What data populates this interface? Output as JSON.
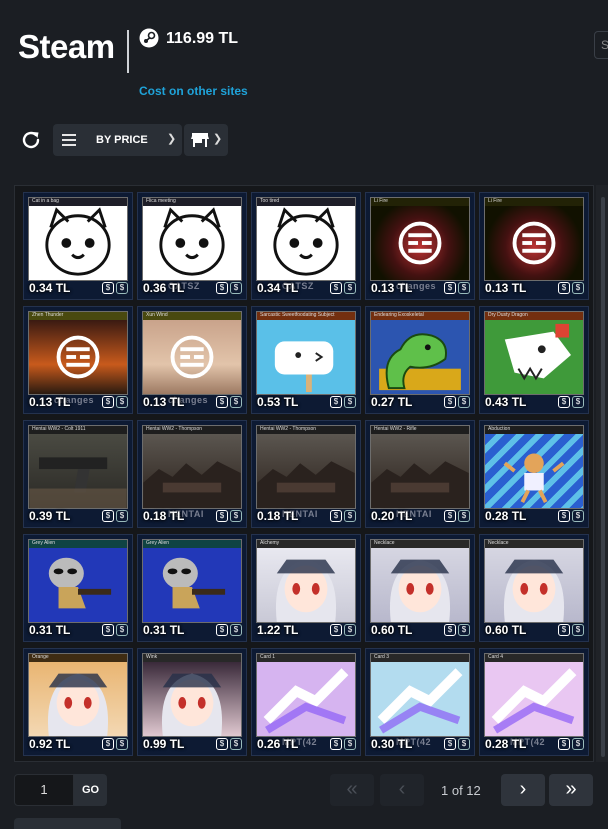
{
  "header": {
    "app_title": "Steam",
    "balance": "116.99 TL",
    "cost_link": "Cost on other sites",
    "search_placeholder": "S"
  },
  "toolbar": {
    "sort_label": "BY PRICE",
    "icons": [
      "refresh-icon",
      "menu-icon",
      "store-icon",
      "chevron-down-icon"
    ]
  },
  "items": [
    {
      "caption": "Cat in a bag",
      "price": "0.34 TL",
      "art": "cat-bag",
      "watermark": ""
    },
    {
      "caption": "Flica meeting",
      "price": "0.36 TL",
      "art": "cat-wink",
      "watermark": "CATSZ"
    },
    {
      "caption": "Too tired",
      "price": "0.34 TL",
      "art": "cat-sleepy",
      "watermark": "CATSZ"
    },
    {
      "caption": "Li Fire",
      "price": "0.13 TL",
      "art": "fire-symbol",
      "watermark": "changes"
    },
    {
      "caption": "Li Fire",
      "price": "0.13 TL",
      "art": "fire-symbol",
      "watermark": ""
    },
    {
      "caption": "Zhen Thunder",
      "price": "0.13 TL",
      "art": "sunset-symbol",
      "watermark": "changes"
    },
    {
      "caption": "Xun Wind",
      "price": "0.13 TL",
      "art": "wind-symbol",
      "watermark": "changes"
    },
    {
      "caption": "Sarcastic Sweetfoodating Subject",
      "price": "0.53 TL",
      "art": "toast-face",
      "watermark": ""
    },
    {
      "caption": "Endearing Exoskeletal",
      "price": "0.27 TL",
      "art": "green-dino",
      "watermark": ""
    },
    {
      "caption": "Dry Dusty Dragon",
      "price": "0.43 TL",
      "art": "skull-dragon",
      "watermark": ""
    },
    {
      "caption": "Hentai WW2 - Colt 1911",
      "price": "0.39 TL",
      "art": "pistol",
      "watermark": ""
    },
    {
      "caption": "Hentai WW2 - Thompson",
      "price": "0.18 TL",
      "art": "ruins",
      "watermark": "HENTAI"
    },
    {
      "caption": "Hentai WW2 - Thompson",
      "price": "0.18 TL",
      "art": "ruins",
      "watermark": "HENTAI"
    },
    {
      "caption": "Hentai WW2 - Rifle",
      "price": "0.20 TL",
      "art": "ruins",
      "watermark": "HENTAI"
    },
    {
      "caption": "Abduction",
      "price": "0.28 TL",
      "art": "abduction",
      "watermark": ""
    },
    {
      "caption": "Grey Alien",
      "price": "0.31 TL",
      "art": "grey-alien",
      "watermark": ""
    },
    {
      "caption": "Grey Alien",
      "price": "0.31 TL",
      "art": "grey-alien",
      "watermark": ""
    },
    {
      "caption": "Alchemy",
      "price": "1.22 TL",
      "art": "anime-girl",
      "watermark": ""
    },
    {
      "caption": "Necklace",
      "price": "0.60 TL",
      "art": "anime-hat",
      "watermark": ""
    },
    {
      "caption": "Necklace",
      "price": "0.60 TL",
      "art": "anime-hat",
      "watermark": ""
    },
    {
      "caption": "Orange",
      "price": "0.92 TL",
      "art": "anime-orange",
      "watermark": ""
    },
    {
      "caption": "Wink",
      "price": "0.99 TL",
      "art": "anime-witch",
      "watermark": ""
    },
    {
      "caption": "Card 1",
      "price": "0.26 TL",
      "art": "card-green",
      "watermark": "MPT(42"
    },
    {
      "caption": "Card 3",
      "price": "0.30 TL",
      "art": "card-blue",
      "watermark": "MPT(42"
    },
    {
      "caption": "Card 4",
      "price": "0.28 TL",
      "art": "card-purple",
      "watermark": "MPT(42"
    }
  ],
  "pager": {
    "page_input": "1",
    "go_label": "GO",
    "page_count": "1 of 12",
    "first_label": "«",
    "prev_label": "‹",
    "next_label": "›",
    "last_label": "»"
  },
  "colors": {
    "background": "#1b1e23",
    "link": "#1fa3d9",
    "card_bg": "#0d1a33"
  }
}
